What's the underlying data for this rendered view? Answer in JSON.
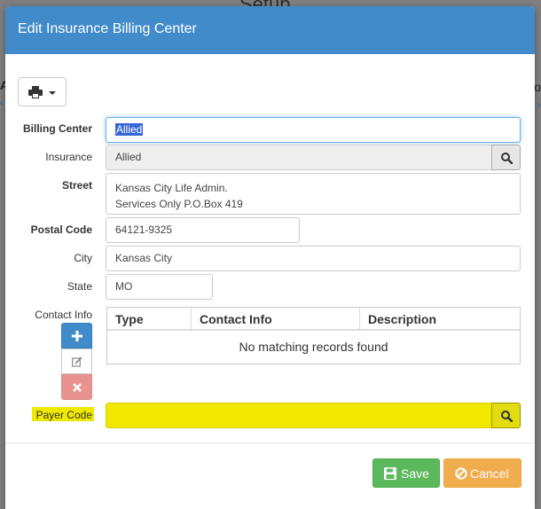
{
  "background": {
    "title": "Setub"
  },
  "modal": {
    "title": "Edit Insurance Billing Center"
  },
  "form": {
    "billing_center": {
      "label": "Billing Center",
      "value": "Allied"
    },
    "insurance": {
      "label": "Insurance",
      "value": "Allied"
    },
    "street": {
      "label": "Street",
      "line1": "Kansas City Life Admin.",
      "line2": "Services Only P.O.Box 419"
    },
    "postal_code": {
      "label": "Postal Code",
      "value": "64121-9325"
    },
    "city": {
      "label": "City",
      "value": "Kansas City"
    },
    "state": {
      "label": "State",
      "value": "MO"
    },
    "contact_info": {
      "label": "Contact Info",
      "columns": [
        "Type",
        "Contact Info",
        "Description"
      ],
      "empty_message": "No matching records found"
    },
    "payer_code": {
      "label": "Payer Code",
      "value": ""
    }
  },
  "footer": {
    "save_label": "Save",
    "cancel_label": "Cancel"
  },
  "colors": {
    "header": "#428bca",
    "highlight": "#f0e800",
    "save": "#5cb85c",
    "cancel": "#f0ad4e",
    "delete": "#e8938f"
  },
  "icons": {
    "print": "print-icon",
    "search": "search-icon",
    "add": "plus-icon",
    "edit": "edit-icon",
    "delete": "times-icon",
    "save": "floppy-icon",
    "cancel": "ban-icon"
  }
}
